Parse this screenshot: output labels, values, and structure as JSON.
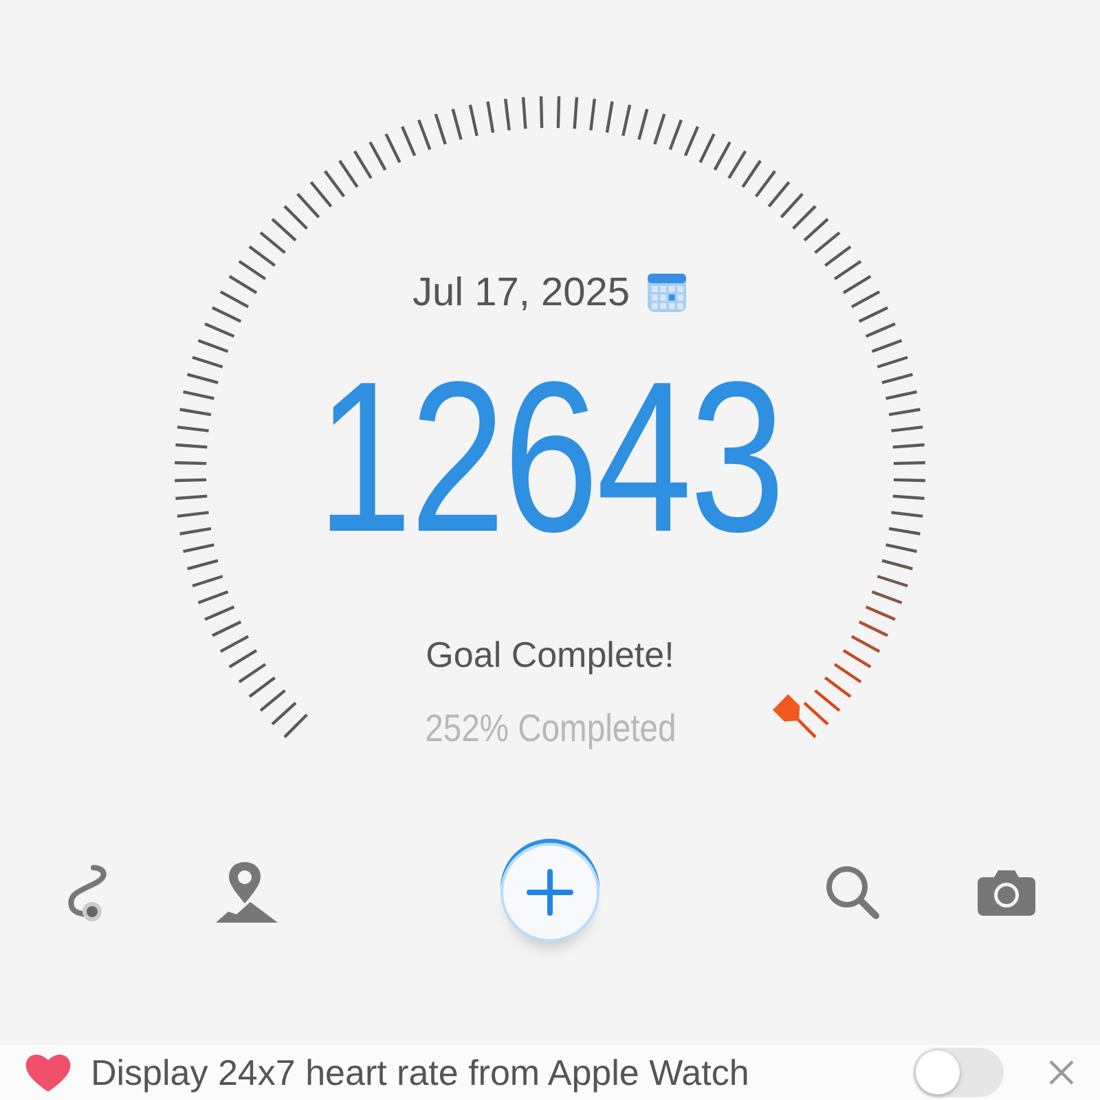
{
  "date": "Jul 17, 2025",
  "steps": "12643",
  "status": "Goal Complete!",
  "percent": "252% Completed",
  "banner": {
    "text": "Display 24x7 heart rate from Apple Watch",
    "on": false
  }
}
